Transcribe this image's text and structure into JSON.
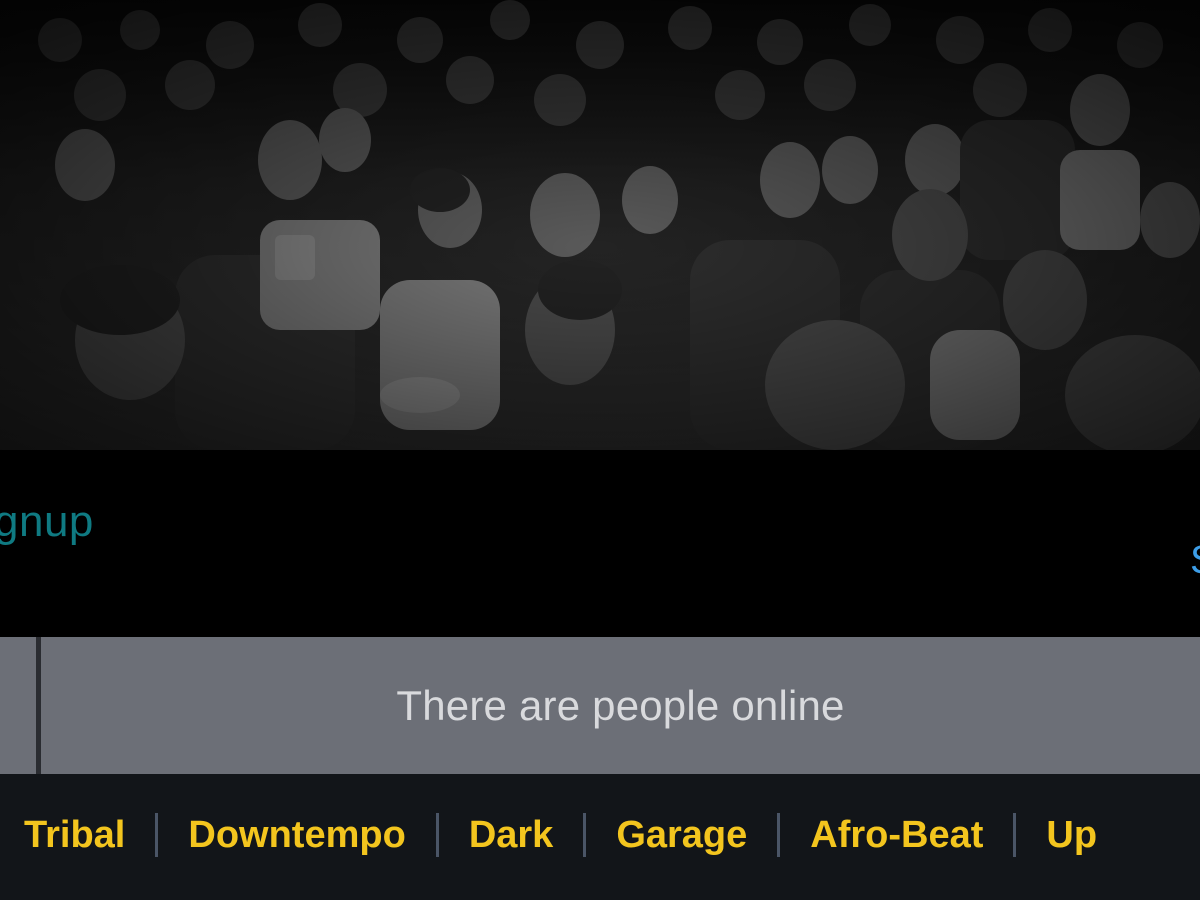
{
  "header": {
    "signup_link": "gnup",
    "edge_link": "S"
  },
  "online": {
    "text": "There are people online"
  },
  "genres": [
    "Tribal",
    "Downtempo",
    "Dark",
    "Garage",
    "Afro-Beat",
    "Up"
  ],
  "colors": {
    "link_teal": "#0f7a82",
    "link_blue": "#3d9ee8",
    "genre_yellow": "#f3c51e",
    "online_bar": "#6c6f77",
    "nav_bg": "#121519"
  }
}
